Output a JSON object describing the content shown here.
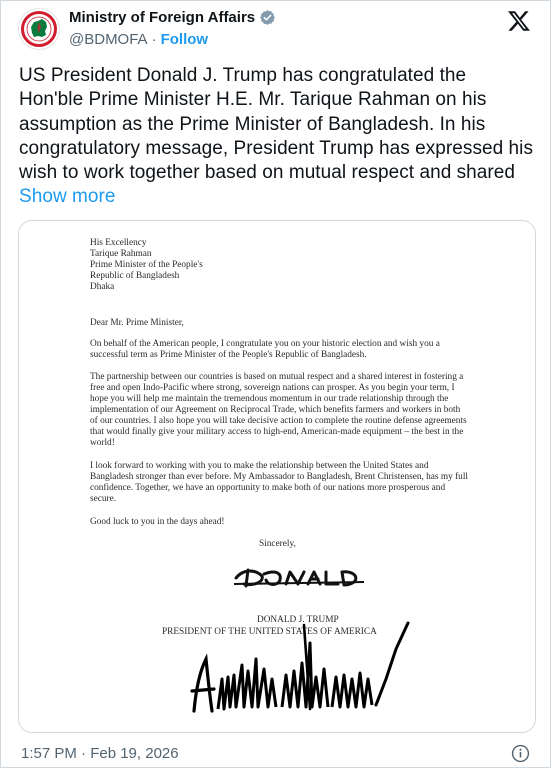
{
  "account": {
    "display_name": "Ministry of Foreign Affairs",
    "handle": "@BDMOFA",
    "separator": "·",
    "follow_label": "Follow",
    "avatar_text": "GOVERNMENT OF BANGLADESH"
  },
  "tweet": {
    "text": "US President Donald J. Trump has congratulated the Hon'ble Prime Minister H.E. Mr. Tarique Rahman on his assumption as the Prime Minister of Bangladesh. In his congratulatory message, President Trump has expressed his wish to work together based on mutual respect and shared",
    "show_more_label": "Show more",
    "timestamp": "1:57 PM · Feb 19, 2026"
  },
  "letter": {
    "address": "His Excellency\nTarique Rahman\nPrime Minister of the People's\n   Republic of Bangladesh\nDhaka",
    "greeting": "Dear Mr. Prime Minister,",
    "p1": "On behalf of the American people, I congratulate you on your historic election and wish you a successful term as Prime Minister of the People's Republic of Bangladesh.",
    "p2": "The partnership between our countries is based on mutual respect and a shared interest in fostering a free and open Indo-Pacific where strong, sovereign nations can prosper. As you begin your term, I hope you will help me maintain the tremendous momentum in our trade relationship through the implementation of our Agreement on Reciprocal Trade, which benefits farmers and workers in both of our countries. I also hope you will take decisive action to complete the routine defense agreements that would finally give your military access to high-end, American-made equipment – the best in the world!",
    "p3": "I look forward to working with you to make the relationship between the United States and Bangladesh stronger than ever before. My Ambassador to Bangladesh, Brent Christensen, has my full confidence. Together, we have an opportunity to make both of our nations more prosperous and secure.",
    "p4": "Good luck to you in the days ahead!",
    "closing": "Sincerely,",
    "signer_name": "DONALD J. TRUMP",
    "signer_title": "PRESIDENT OF THE UNITED STATES OF AMERICA",
    "signature_text": "DONALD"
  },
  "icons": {
    "verified": "verified-badge-icon",
    "x_logo": "x-logo-icon",
    "info": "info-icon"
  },
  "colors": {
    "accent": "#1d9bf0",
    "muted": "#536471",
    "avatar_green": "#006a4e",
    "avatar_red": "#f42a41"
  }
}
